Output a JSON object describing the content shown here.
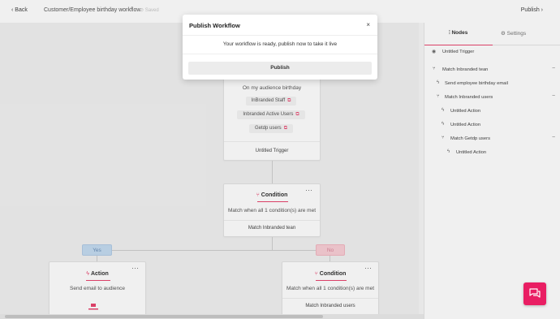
{
  "topbar": {
    "back_label": "‹ Back",
    "breadcrumb": "Customer/Employee birthday workflow",
    "saved_label": "⊘ Saved",
    "publish_label": "Publish ›"
  },
  "sidebar": {
    "tab_nodes": "Nodes",
    "tab_settings": "Settings",
    "tree": [
      {
        "label": "Untitled Trigger"
      },
      {
        "label": "Match Inbranded tean"
      },
      {
        "label": "Send employee birthday email"
      },
      {
        "label": "Match Inbranded users"
      },
      {
        "label": "Untitled Action"
      },
      {
        "label": "Untitled Action"
      },
      {
        "label": "Match Getdp users"
      },
      {
        "label": "Untitled Action"
      }
    ]
  },
  "trigger_node": {
    "desc": "On my audience birthday",
    "tags": [
      "InBranded Staff",
      "Inbranded Active Users",
      "Getdp users"
    ],
    "footer": "Untitled Trigger"
  },
  "condition_node_1": {
    "title": "Condition",
    "desc": "Match when all 1 condition(s) are met",
    "footer": "Match Inbranded tean"
  },
  "branches": {
    "yes": "Yes",
    "no": "No"
  },
  "action_node": {
    "title": "Action",
    "desc": "Send email to audience"
  },
  "condition_node_2": {
    "title": "Condition",
    "desc": "Match when all 1 condition(s) are met",
    "footer": "Match Inbranded users"
  },
  "modal": {
    "title": "Publish Workflow",
    "close": "×",
    "message": "Your workflow is ready, publish now to take it live",
    "button": "Publish"
  },
  "colors": {
    "accent": "#e8446e",
    "chat": "#e91e63",
    "yes": "#c4dbf1",
    "no": "#f9cfd6"
  }
}
